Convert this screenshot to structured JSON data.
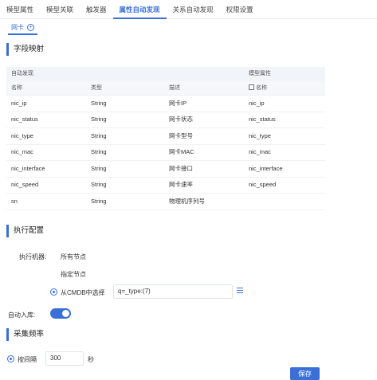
{
  "tabs": [
    "模型属性",
    "模型关联",
    "触发器",
    "属性自动发现",
    "关系自动发现",
    "权限设置"
  ],
  "active_tab": "属性自动发现",
  "sub_tab": {
    "label": "网卡",
    "add_icon": "plus-circle-icon"
  },
  "field_mapping": {
    "title": "字段映射",
    "group_auto": "自动发现",
    "group_model": "模型属性",
    "headers": [
      "名称",
      "类型",
      "描述",
      "名称"
    ],
    "rows": [
      [
        "nic_ip",
        "String",
        "网卡IP",
        "nic_ip"
      ],
      [
        "nic_status",
        "String",
        "网卡状态",
        "nic_status"
      ],
      [
        "nic_type",
        "String",
        "网卡型号",
        "nic_type"
      ],
      [
        "nic_mac",
        "String",
        "网卡MAC",
        "nic_mac"
      ],
      [
        "nic_interface",
        "String",
        "网卡接口",
        "nic_interface"
      ],
      [
        "nic_speed",
        "String",
        "网卡速率",
        "nic_speed"
      ],
      [
        "sn",
        "String",
        "物理机序列号",
        ""
      ]
    ]
  },
  "exec_config": {
    "title": "执行配置",
    "machine_label": "执行机器:",
    "options": [
      "所有节点",
      "指定节点",
      "从CMDB中选择"
    ],
    "selected_option": "从CMDB中选择",
    "query_value": "q=_type:(7)",
    "auto_import_label": "自动入库:",
    "auto_import_on": true
  },
  "frequency": {
    "title": "采集频率",
    "mode_label": "按间隔",
    "interval_value": "300",
    "unit": "秒"
  },
  "save_label": "保存",
  "colors": {
    "accent": "#3a6fd8"
  }
}
